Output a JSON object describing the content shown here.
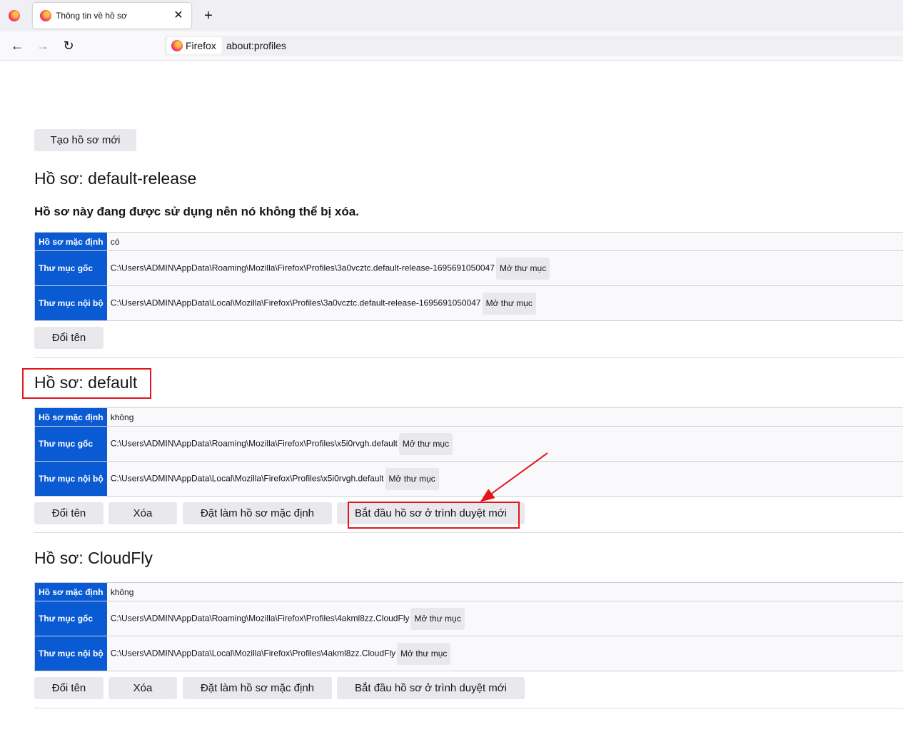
{
  "browser": {
    "tab_title": "Thông tin về hồ sơ",
    "tab_close": "✕",
    "new_tab": "+",
    "back": "←",
    "forward": "→",
    "reload": "↻",
    "identity_label": "Firefox",
    "url": "about:profiles"
  },
  "page": {
    "create_button": "Tạo hồ sơ mới",
    "in_use_notice": "Hồ sơ này đang được sử dụng nên nó không thể bị xóa.",
    "labels": {
      "default_profile": "Hồ sơ mặc định",
      "root_dir": "Thư mục gốc",
      "local_dir": "Thư mục nội bộ",
      "open_folder": "Mở thư mục",
      "rename": "Đổi tên",
      "remove": "Xóa",
      "set_default": "Đặt làm hồ sơ mặc định",
      "launch": "Bắt đầu hồ sơ ở trình duyệt mới"
    },
    "profiles": [
      {
        "heading": "Hồ sơ: default-release",
        "is_default": "có",
        "root_dir": "C:\\Users\\ADMIN\\AppData\\Roaming\\Mozilla\\Firefox\\Profiles\\3a0vcztc.default-release-1695691050047",
        "local_dir": "C:\\Users\\ADMIN\\AppData\\Local\\Mozilla\\Firefox\\Profiles\\3a0vcztc.default-release-1695691050047"
      },
      {
        "heading": "Hồ sơ: default",
        "is_default": "không",
        "root_dir": "C:\\Users\\ADMIN\\AppData\\Roaming\\Mozilla\\Firefox\\Profiles\\x5i0rvgh.default",
        "local_dir": "C:\\Users\\ADMIN\\AppData\\Local\\Mozilla\\Firefox\\Profiles\\x5i0rvgh.default"
      },
      {
        "heading": "Hồ sơ: CloudFly",
        "is_default": "không",
        "root_dir": "C:\\Users\\ADMIN\\AppData\\Roaming\\Mozilla\\Firefox\\Profiles\\4akml8zz.CloudFly",
        "local_dir": "C:\\Users\\ADMIN\\AppData\\Local\\Mozilla\\Firefox\\Profiles\\4akml8zz.CloudFly"
      }
    ]
  },
  "annotations": {
    "color": "#e5141b"
  }
}
